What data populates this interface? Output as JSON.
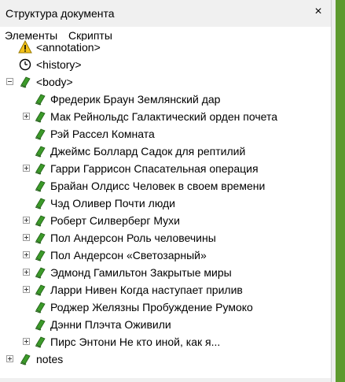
{
  "panel": {
    "title": "Структура документа",
    "close_glyph": "×",
    "tabs": [
      "Элементы",
      "Скрипты"
    ]
  },
  "tree": {
    "annotation": "<annotation>",
    "history": "<history>",
    "body": "<body>",
    "sections": [
      {
        "label": "Фредерик Браун Землянский дар",
        "expandable": false
      },
      {
        "label": "Мак Рейнольдс Галактический орден почета",
        "expandable": true
      },
      {
        "label": "Рэй Рассел Комната",
        "expandable": false
      },
      {
        "label": "Джеймс Боллард Садок для рептилий",
        "expandable": false
      },
      {
        "label": "Гарри Гаррисон Спасательная операция",
        "expandable": true
      },
      {
        "label": "Брайан Олдисс Человек в своем времени",
        "expandable": false
      },
      {
        "label": "Чэд Оливер Почти люди",
        "expandable": false
      },
      {
        "label": "Роберт Силверберг Мухи",
        "expandable": true
      },
      {
        "label": "Пол Андерсон Роль человечины",
        "expandable": true
      },
      {
        "label": "Пол Андерсон «Светозарный»",
        "expandable": true
      },
      {
        "label": "Эдмонд Гамильтон Закрытые миры",
        "expandable": true
      },
      {
        "label": "Ларри Нивен Когда наступает прилив",
        "expandable": true
      },
      {
        "label": "Роджер Желязны Пробуждение Румоко",
        "expandable": false
      },
      {
        "label": "Дэнни Плэчта Оживили",
        "expandable": false
      },
      {
        "label": "Пирс Энтони Не кто иной, как я...",
        "expandable": true
      }
    ],
    "notes": "notes"
  },
  "icons": {
    "annotation": "warning-icon",
    "history": "clock-icon",
    "section": "book-icon"
  },
  "colors": {
    "book_green": "#3c9a2a",
    "warning_yellow": "#f4c21b",
    "side_strip": "#5d9a2e"
  }
}
